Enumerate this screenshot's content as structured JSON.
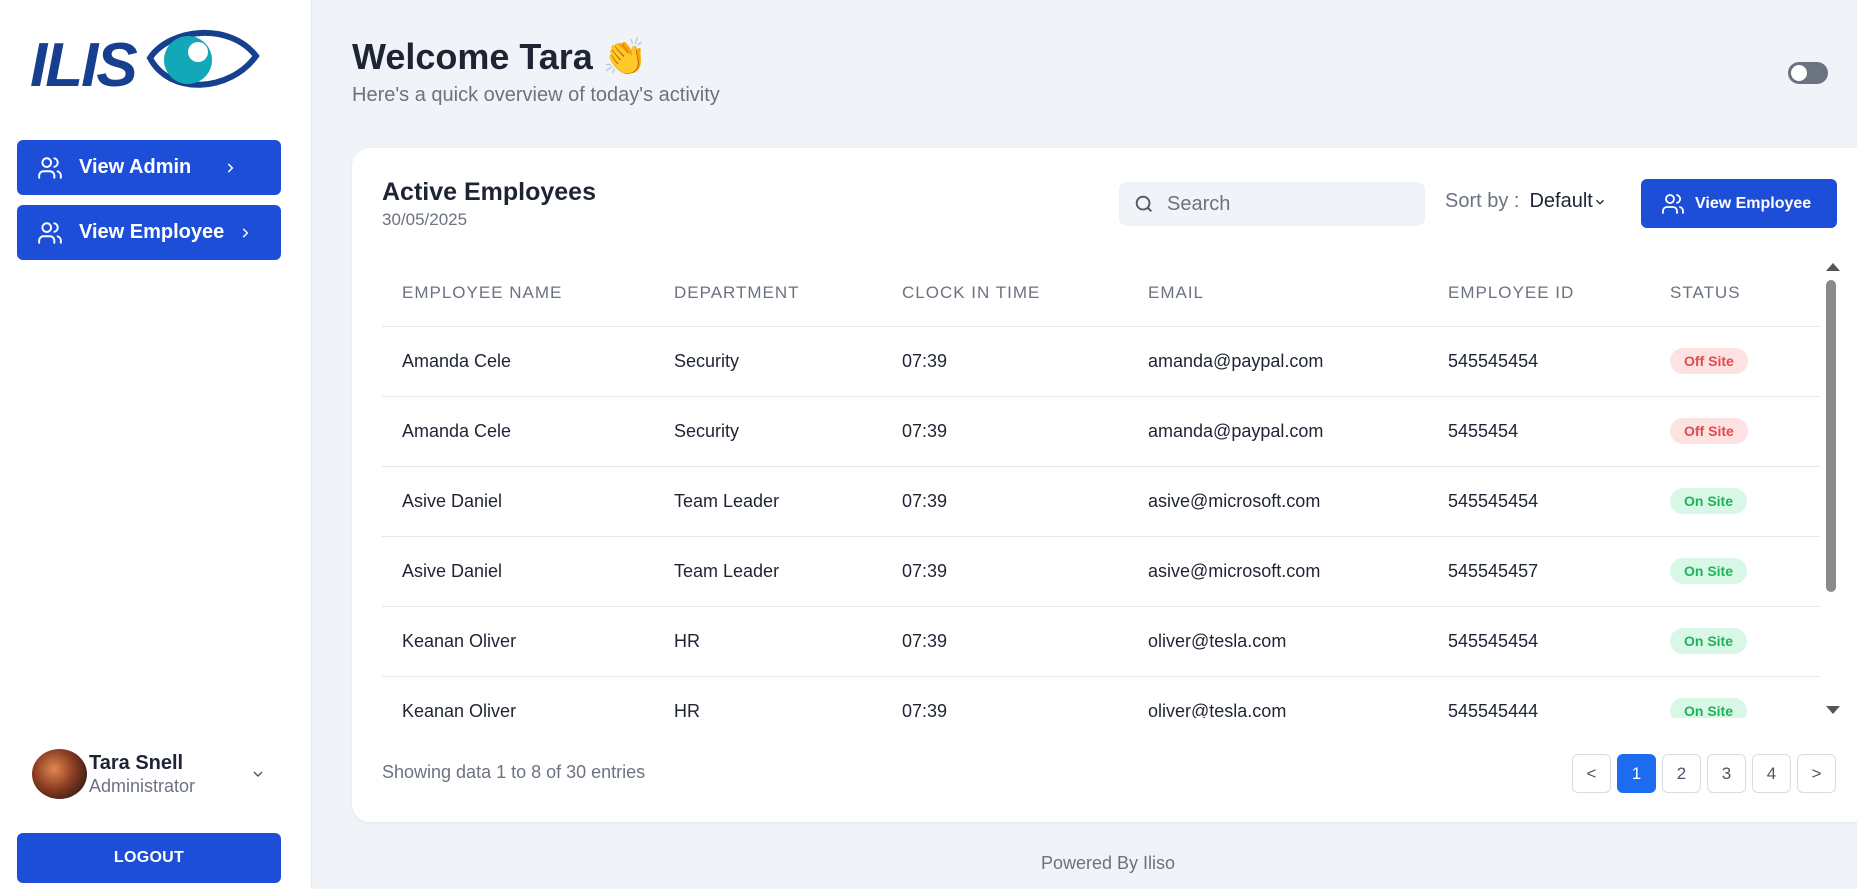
{
  "sidebar": {
    "logo_text": "ILISO",
    "nav": [
      {
        "label": "View Admin",
        "icon": "users-icon"
      },
      {
        "label": "View Employee",
        "icon": "users-icon"
      }
    ],
    "user": {
      "name": "Tara Snell",
      "role": "Administrator"
    },
    "logout_label": "LOGOUT"
  },
  "header": {
    "welcome": "Welcome Tara 👏",
    "subtitle": "Here's a quick overview of today's activity"
  },
  "card": {
    "title": "Active Employees",
    "date": "30/05/2025",
    "search_placeholder": "Search",
    "sort_label": "Sort by :",
    "sort_value": "Default",
    "view_employee_label": "View Employee",
    "columns": [
      "EMPLOYEE NAME",
      "DEPARTMENT",
      "CLOCK IN TIME",
      "EMAIL",
      "EMPLOYEE ID",
      "STATUS"
    ],
    "rows": [
      {
        "name": "Amanda Cele",
        "department": "Security",
        "clock_in": "07:39",
        "email": "amanda@paypal.com",
        "id": "545545454",
        "status": "Off Site"
      },
      {
        "name": "Amanda Cele",
        "department": "Security",
        "clock_in": "07:39",
        "email": "amanda@paypal.com",
        "id": "5455454",
        "status": "Off Site"
      },
      {
        "name": "Asive Daniel",
        "department": "Team Leader",
        "clock_in": "07:39",
        "email": "asive@microsoft.com",
        "id": "545545454",
        "status": "On Site"
      },
      {
        "name": "Asive Daniel",
        "department": "Team Leader",
        "clock_in": "07:39",
        "email": "asive@microsoft.com",
        "id": "545545457",
        "status": "On Site"
      },
      {
        "name": "Keanan Oliver",
        "department": "HR",
        "clock_in": "07:39",
        "email": "oliver@tesla.com",
        "id": "545545454",
        "status": "On Site"
      },
      {
        "name": "Keanan Oliver",
        "department": "HR",
        "clock_in": "07:39",
        "email": "oliver@tesla.com",
        "id": "545545444",
        "status": "On Site"
      }
    ],
    "showing": "Showing data 1 to 8 of 30 entries",
    "pagination": {
      "prev": "<",
      "pages": [
        "1",
        "2",
        "3",
        "4"
      ],
      "active": "1",
      "next": ">"
    }
  },
  "footer": "Powered By Iliso",
  "colors": {
    "primary": "#1d4ed8",
    "page_active": "#1d6cf0",
    "off_site": "#e5484d",
    "on_site": "#1fb35a"
  }
}
